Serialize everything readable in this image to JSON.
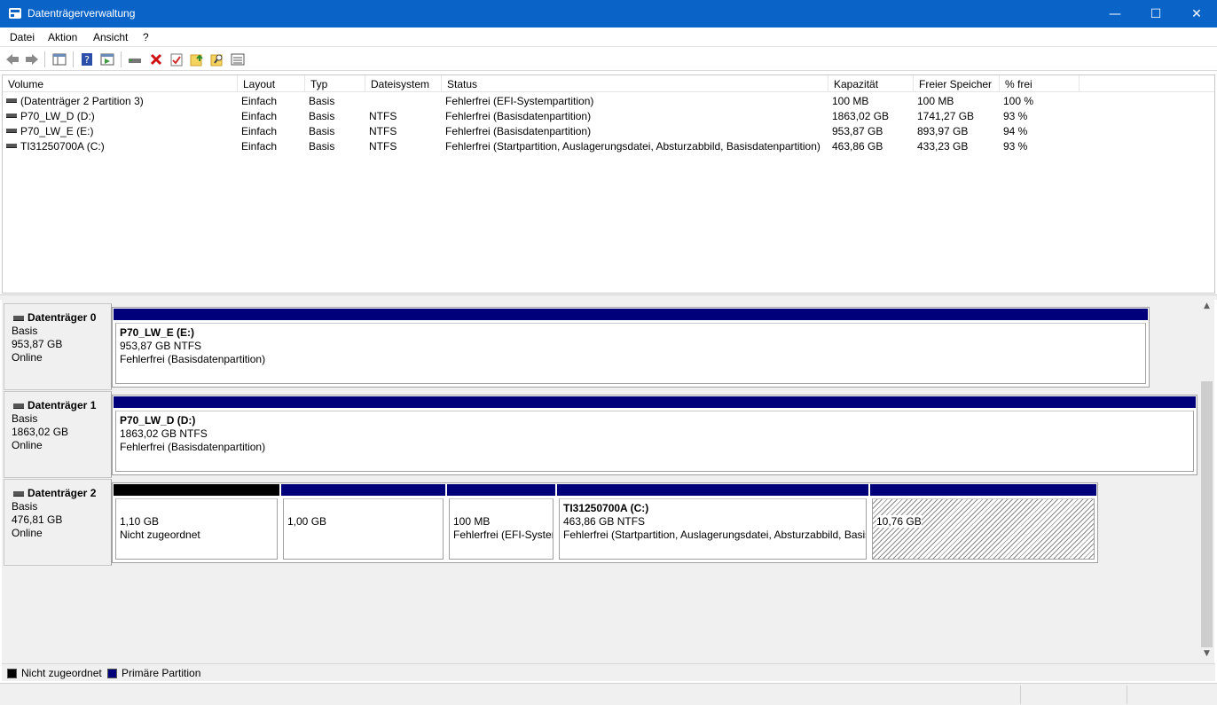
{
  "window": {
    "title": "Datenträgerverwaltung",
    "min_glyph": "—",
    "max_glyph": "☐",
    "close_glyph": "✕"
  },
  "menu": [
    "Datei",
    "Aktion",
    "Ansicht",
    "?"
  ],
  "toolbar": {
    "icons": [
      "back-arrow-icon",
      "forward-arrow-icon",
      "console-tree-icon",
      "help-icon",
      "properties-pane-icon",
      "connect-drive-icon",
      "delete-icon",
      "check-icon",
      "upload-folder-icon",
      "search-folder-icon",
      "list-view-icon"
    ]
  },
  "list": {
    "columns": [
      "Volume",
      "Layout",
      "Typ",
      "Dateisystem",
      "Status",
      "Kapazität",
      "Freier Speicher",
      "% frei"
    ],
    "rows": [
      [
        "(Datenträger 2 Partition 3)",
        "Einfach",
        "Basis",
        "",
        "Fehlerfrei (EFI-Systempartition)",
        "100 MB",
        "100 MB",
        "100 %"
      ],
      [
        "P70_LW_D (D:)",
        "Einfach",
        "Basis",
        "NTFS",
        "Fehlerfrei (Basisdatenpartition)",
        "1863,02 GB",
        "1741,27 GB",
        "93 %"
      ],
      [
        "P70_LW_E (E:)",
        "Einfach",
        "Basis",
        "NTFS",
        "Fehlerfrei (Basisdatenpartition)",
        "953,87 GB",
        "893,97 GB",
        "94 %"
      ],
      [
        "TI31250700A (C:)",
        "Einfach",
        "Basis",
        "NTFS",
        "Fehlerfrei (Startpartition, Auslagerungsdatei, Absturzabbild, Basisdatenpartition)",
        "463,86 GB",
        "433,23 GB",
        "93 %"
      ]
    ]
  },
  "disks": [
    {
      "name": "Datenträger 0",
      "type": "Basis",
      "size": "953,87 GB",
      "state": "Online",
      "partitions": [
        {
          "title": "P70_LW_E  (E:)",
          "line1": "953,87 GB NTFS",
          "line2": "Fehlerfrei (Basisdatenpartition)"
        }
      ]
    },
    {
      "name": "Datenträger 1",
      "type": "Basis",
      "size": "1863,02 GB",
      "state": "Online",
      "partitions": [
        {
          "title": "P70_LW_D  (D:)",
          "line1": "1863,02 GB NTFS",
          "line2": "Fehlerfrei (Basisdatenpartition)"
        }
      ]
    },
    {
      "name": "Datenträger 2",
      "type": "Basis",
      "size": "476,81 GB",
      "state": "Online",
      "partitions": [
        {
          "title": "",
          "line1": "1,10 GB",
          "line2": "Nicht zugeordnet"
        },
        {
          "title": "",
          "line1": "1,00 GB",
          "line2": ""
        },
        {
          "title": "",
          "line1": "100 MB",
          "line2": "Fehlerfrei (EFI-System"
        },
        {
          "title": "TI31250700A  (C:)",
          "line1": "463,86 GB NTFS",
          "line2": "Fehlerfrei (Startpartition, Auslagerungsdatei, Absturzabbild, Basis"
        },
        {
          "title": "",
          "line1": "10,76 GB",
          "line2": ""
        }
      ]
    }
  ],
  "legend": {
    "unallocated": "Nicht zugeordnet",
    "primary": "Primäre Partition"
  },
  "colors": {
    "title_bar": "#0a64c8",
    "primary_partition": "#00007b",
    "unallocated": "#000000"
  }
}
